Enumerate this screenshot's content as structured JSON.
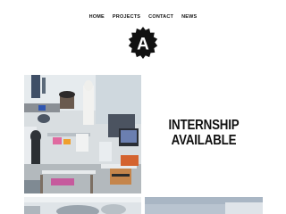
{
  "nav": {
    "items": [
      {
        "label": "HOME"
      },
      {
        "label": "PROJECTS"
      },
      {
        "label": "CONTACT"
      },
      {
        "label": "NEWS"
      }
    ]
  },
  "logo": {
    "letter": "A"
  },
  "feature": {
    "headline_line1": "INTERNSHIP",
    "headline_line2": "AVAILABLE"
  }
}
